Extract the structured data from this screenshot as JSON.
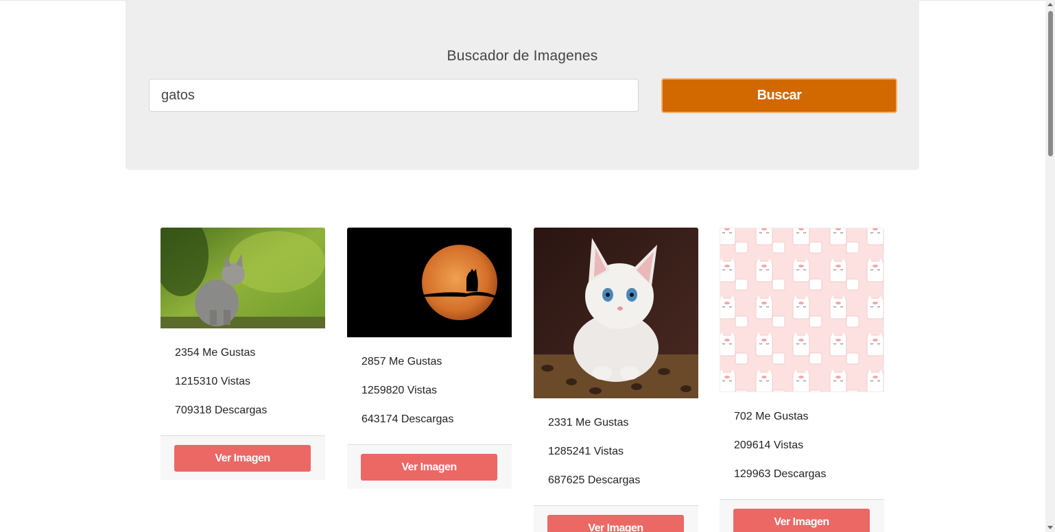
{
  "header": {
    "title": "Buscador de Imagenes"
  },
  "search": {
    "value": "gatos",
    "button_label": "Buscar"
  },
  "results": [
    {
      "likes": "2354 Me Gustas",
      "views": "1215310 Vistas",
      "downloads": "709318 Descargas",
      "button_label": "Ver Imagen",
      "image_subject": "kitten-in-grass"
    },
    {
      "likes": "2857 Me Gustas",
      "views": "1259820 Vistas",
      "downloads": "643174 Descargas",
      "button_label": "Ver Imagen",
      "image_subject": "cat-silhouette-full-moon"
    },
    {
      "likes": "2331 Me Gustas",
      "views": "1285241 Vistas",
      "downloads": "687625 Descargas",
      "button_label": "Ver Imagen",
      "image_subject": "white-kitten"
    },
    {
      "likes": "702 Me Gustas",
      "views": "209614 Vistas",
      "downloads": "129963 Descargas",
      "button_label": "Ver Imagen",
      "image_subject": "pink-cat-pattern"
    }
  ],
  "colors": {
    "search_button": "#d16800",
    "view_button": "#ec6865",
    "jumbotron_bg": "#eeeeee"
  }
}
